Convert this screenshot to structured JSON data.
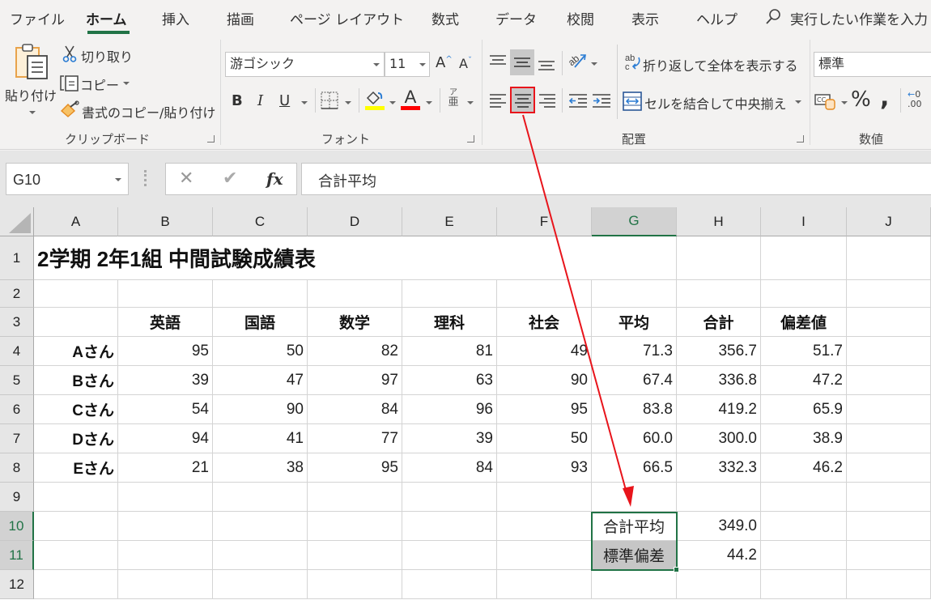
{
  "menu": {
    "tabs": [
      "ファイル",
      "ホーム",
      "挿入",
      "描画",
      "ページ レイアウト",
      "数式",
      "データ",
      "校閲",
      "表示",
      "ヘルプ"
    ],
    "active_tab": "ホーム",
    "search_placeholder": "実行したい作業を入力"
  },
  "ribbon": {
    "clipboard": {
      "paste": "貼り付け",
      "cut": "切り取り",
      "copy": "コピー",
      "format_painter": "書式のコピー/貼り付け",
      "label": "クリップボード"
    },
    "font": {
      "font_name": "游ゴシック",
      "font_size": "11",
      "grow": "A",
      "shrink": "A",
      "bold": "B",
      "italic": "I",
      "underline": "U",
      "font_color_letter": "A",
      "phonetic_top": "ア",
      "phonetic_bottom": "亜",
      "fill_color": "#ffff00",
      "font_color": "#ff0000",
      "label": "フォント"
    },
    "alignment": {
      "wrap_text": "折り返して全体を表示する",
      "merge_center": "セルを結合して中央揃え",
      "label": "配置",
      "highlighted_button": "center-align"
    },
    "number": {
      "format": "標準",
      "percent": "%",
      "comma": "❟",
      "label": "数値"
    }
  },
  "formula_bar": {
    "name_box": "G10",
    "fx": "fx",
    "content": "合計平均"
  },
  "sheet": {
    "columns": [
      "A",
      "B",
      "C",
      "D",
      "E",
      "F",
      "G",
      "H",
      "I",
      "J"
    ],
    "rows": [
      "1",
      "2",
      "3",
      "4",
      "5",
      "6",
      "7",
      "8",
      "9",
      "10",
      "11",
      "12"
    ],
    "selected_column": "G",
    "selected_rows": [
      "10",
      "11"
    ],
    "title": "2学期 2年1組 中間試験成績表",
    "headers": [
      "英語",
      "国語",
      "数学",
      "理科",
      "社会",
      "平均",
      "合計",
      "偏差値"
    ],
    "students": [
      {
        "name": "Aさん",
        "scores": [
          "95",
          "50",
          "82",
          "81",
          "49"
        ],
        "avg": "71.3",
        "total": "356.7",
        "dev": "51.7"
      },
      {
        "name": "Bさん",
        "scores": [
          "39",
          "47",
          "97",
          "63",
          "90"
        ],
        "avg": "67.4",
        "total": "336.8",
        "dev": "47.2"
      },
      {
        "name": "Cさん",
        "scores": [
          "54",
          "90",
          "84",
          "96",
          "95"
        ],
        "avg": "83.8",
        "total": "419.2",
        "dev": "65.9"
      },
      {
        "name": "Dさん",
        "scores": [
          "94",
          "41",
          "77",
          "39",
          "50"
        ],
        "avg": "60.0",
        "total": "300.0",
        "dev": "38.9"
      },
      {
        "name": "Eさん",
        "scores": [
          "21",
          "38",
          "95",
          "84",
          "93"
        ],
        "avg": "66.5",
        "total": "332.3",
        "dev": "46.2"
      }
    ],
    "summary": [
      {
        "label": "合計平均",
        "value": "349.0"
      },
      {
        "label": "標準偏差",
        "value": "44.2"
      }
    ]
  },
  "annotation": {
    "color": "#e8141b"
  }
}
